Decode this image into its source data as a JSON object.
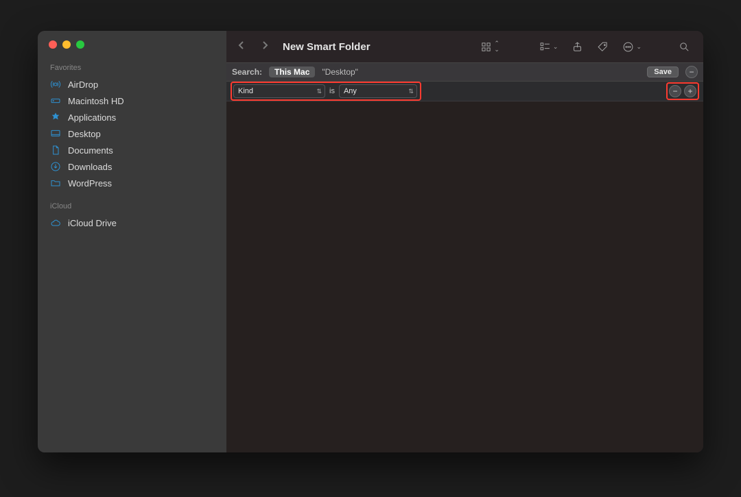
{
  "window": {
    "title": "New Smart Folder"
  },
  "sidebar": {
    "sections": [
      {
        "label": "Favorites",
        "items": [
          {
            "icon": "airdrop",
            "label": "AirDrop"
          },
          {
            "icon": "disk",
            "label": "Macintosh HD"
          },
          {
            "icon": "apps",
            "label": "Applications"
          },
          {
            "icon": "desktop",
            "label": "Desktop"
          },
          {
            "icon": "document",
            "label": "Documents"
          },
          {
            "icon": "download",
            "label": "Downloads"
          },
          {
            "icon": "folder",
            "label": "WordPress"
          }
        ]
      },
      {
        "label": "iCloud",
        "items": [
          {
            "icon": "cloud",
            "label": "iCloud Drive"
          }
        ]
      }
    ]
  },
  "toolbar": {
    "back_label": "‹",
    "forward_label": "›"
  },
  "searchbar": {
    "label": "Search:",
    "scope_active": "This Mac",
    "scope_other": "\"Desktop\"",
    "save_label": "Save",
    "remove_label": "−"
  },
  "criteria": {
    "attribute": "Kind",
    "operator": "is",
    "value": "Any",
    "minus": "−",
    "plus": "+"
  }
}
